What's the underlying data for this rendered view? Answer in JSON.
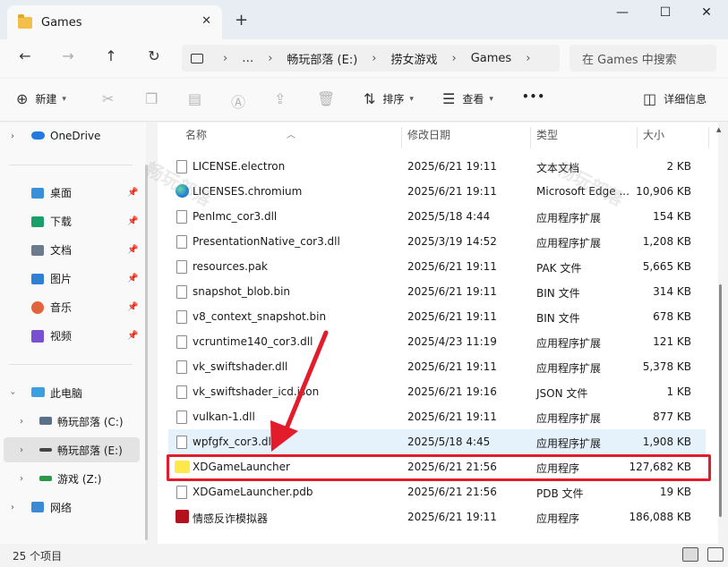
{
  "window": {
    "tab_title": "Games",
    "tab_close": "✕",
    "new_tab": "+",
    "min": "—",
    "max": "☐",
    "close": "✕"
  },
  "nav": {
    "back": "←",
    "forward": "→",
    "up": "↑",
    "refresh": "↻",
    "breadcrumb": [
      "…",
      "畅玩部落 (E:)",
      "捞女游戏",
      "Games"
    ],
    "search_placeholder": "在 Games 中搜索"
  },
  "toolbar": {
    "new_label": "新建",
    "sort_label": "排序",
    "view_label": "查看",
    "more_label": "•••",
    "details_label": "详细信息"
  },
  "sidebar": {
    "onedrive": "OneDrive",
    "quick": [
      {
        "label": "桌面",
        "icon": "desktop-icon",
        "color": "#3b8fd9"
      },
      {
        "label": "下载",
        "icon": "download-icon",
        "color": "#1a9e6a"
      },
      {
        "label": "文档",
        "icon": "document-icon",
        "color": "#6b7b8c"
      },
      {
        "label": "图片",
        "icon": "pictures-icon",
        "color": "#2f7fd2"
      },
      {
        "label": "音乐",
        "icon": "music-icon",
        "color": "#e2643b"
      },
      {
        "label": "视频",
        "icon": "video-icon",
        "color": "#7b4fd2"
      }
    ],
    "pc_label": "此电脑",
    "drives": [
      {
        "label": "畅玩部落 (C:)"
      },
      {
        "label": "畅玩部落 (E:)"
      },
      {
        "label": "游戏 (Z:)"
      }
    ],
    "network_label": "网络"
  },
  "columns": {
    "name": "名称",
    "date": "修改日期",
    "type": "类型",
    "size": "大小"
  },
  "files": [
    {
      "name": "LICENSE.electron",
      "date": "2025/6/21 19:11",
      "type": "文本文档",
      "size": "2 KB",
      "icon": "file"
    },
    {
      "name": "LICENSES.chromium",
      "date": "2025/6/21 19:11",
      "type": "Microsoft Edge ...",
      "size": "10,906 KB",
      "icon": "edge"
    },
    {
      "name": "PenImc_cor3.dll",
      "date": "2025/5/18 4:44",
      "type": "应用程序扩展",
      "size": "154 KB",
      "icon": "file"
    },
    {
      "name": "PresentationNative_cor3.dll",
      "date": "2025/3/19 14:52",
      "type": "应用程序扩展",
      "size": "1,208 KB",
      "icon": "file"
    },
    {
      "name": "resources.pak",
      "date": "2025/6/21 19:11",
      "type": "PAK 文件",
      "size": "5,665 KB",
      "icon": "file"
    },
    {
      "name": "snapshot_blob.bin",
      "date": "2025/6/21 19:11",
      "type": "BIN 文件",
      "size": "314 KB",
      "icon": "file"
    },
    {
      "name": "v8_context_snapshot.bin",
      "date": "2025/6/21 19:11",
      "type": "BIN 文件",
      "size": "678 KB",
      "icon": "file"
    },
    {
      "name": "vcruntime140_cor3.dll",
      "date": "2025/4/23 11:19",
      "type": "应用程序扩展",
      "size": "121 KB",
      "icon": "file"
    },
    {
      "name": "vk_swiftshader.dll",
      "date": "2025/6/21 19:11",
      "type": "应用程序扩展",
      "size": "5,378 KB",
      "icon": "file"
    },
    {
      "name": "vk_swiftshader_icd.json",
      "date": "2025/6/21 19:16",
      "type": "JSON 文件",
      "size": "1 KB",
      "icon": "file"
    },
    {
      "name": "vulkan-1.dll",
      "date": "2025/6/21 19:11",
      "type": "应用程序扩展",
      "size": "877 KB",
      "icon": "file"
    },
    {
      "name": "wpfgfx_cor3.dll",
      "date": "2025/5/18 4:45",
      "type": "应用程序扩展",
      "size": "1,908 KB",
      "icon": "file",
      "selected": true
    },
    {
      "name": "XDGameLauncher",
      "date": "2025/6/21 21:56",
      "type": "应用程序",
      "size": "127,682 KB",
      "icon": "xd"
    },
    {
      "name": "XDGameLauncher.pdb",
      "date": "2025/6/21 21:56",
      "type": "PDB 文件",
      "size": "19 KB",
      "icon": "file"
    },
    {
      "name": "情感反诈模拟器",
      "date": "2025/6/21 19:11",
      "type": "应用程序",
      "size": "186,088 KB",
      "icon": "red"
    }
  ],
  "status": {
    "count": "25 个项目"
  },
  "colors": {
    "highlight": "#e31c2b",
    "selection": "#e5f1fb"
  }
}
